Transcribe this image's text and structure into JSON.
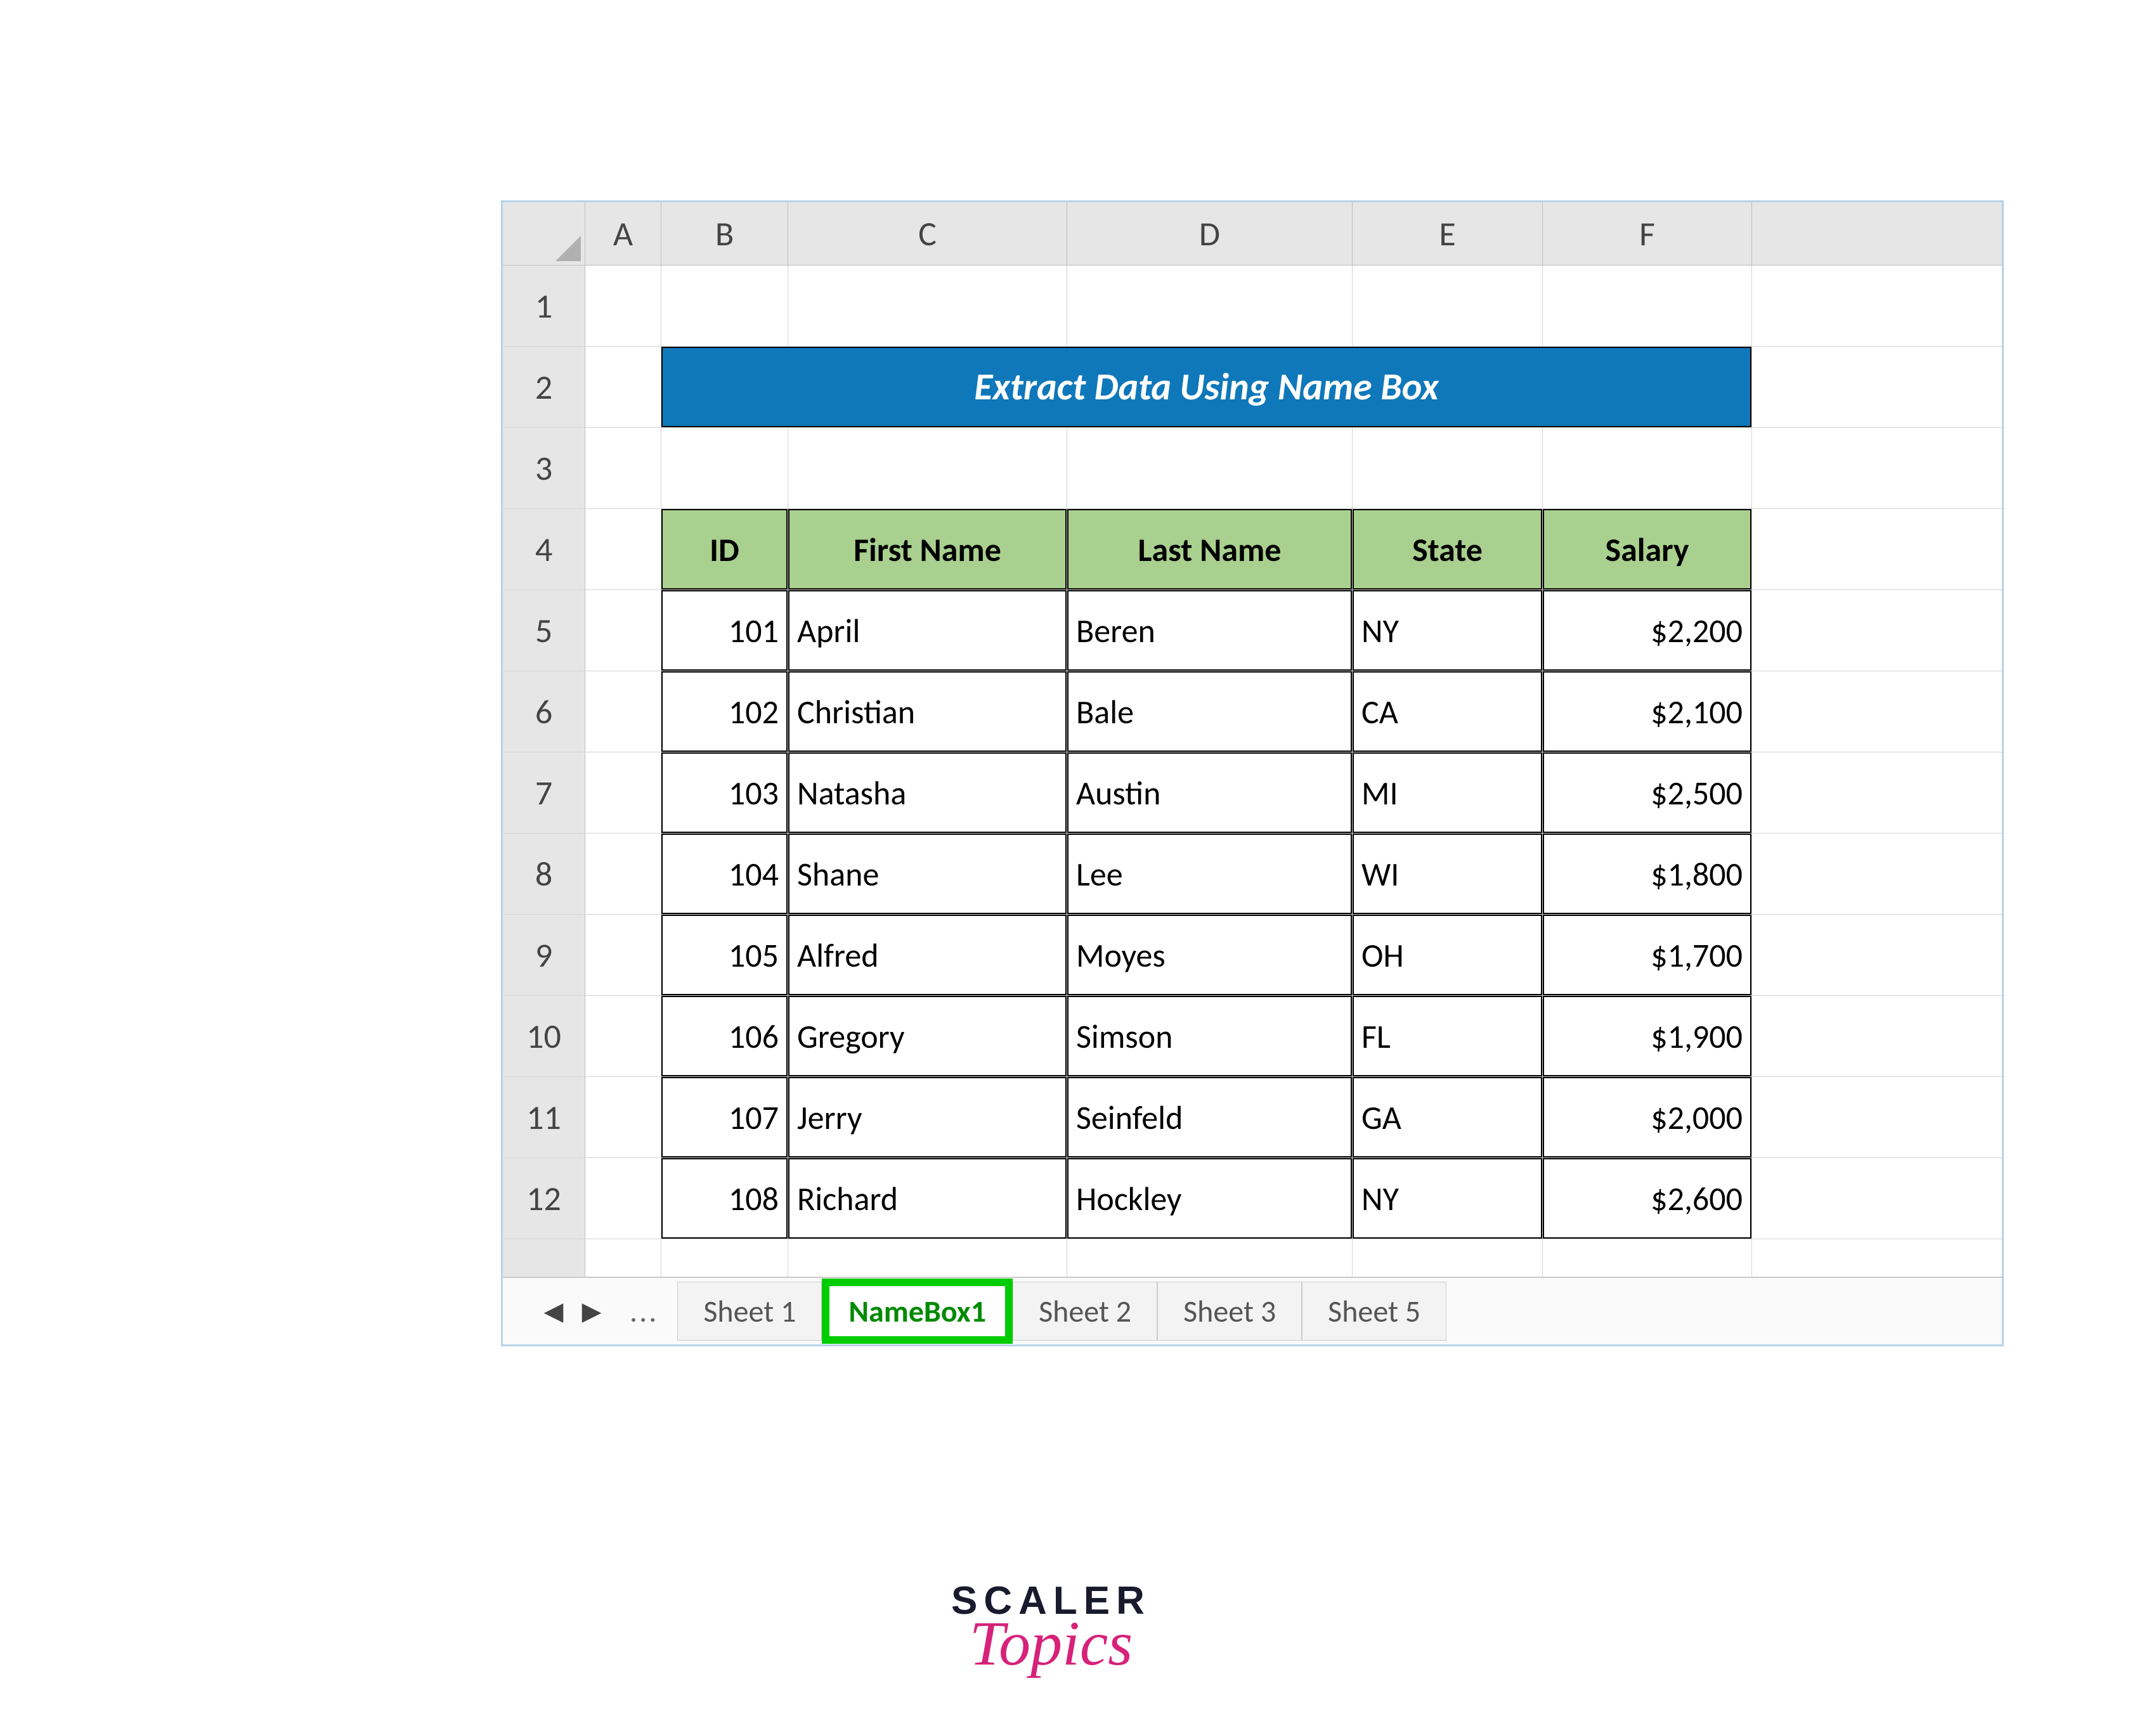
{
  "columns": [
    "A",
    "B",
    "C",
    "D",
    "E",
    "F"
  ],
  "row_numbers": [
    "1",
    "2",
    "3",
    "4",
    "5",
    "6",
    "7",
    "8",
    "9",
    "10",
    "11",
    "12"
  ],
  "banner_title": "Extract Data Using Name Box",
  "table": {
    "headers": [
      "ID",
      "First Name",
      "Last Name",
      "State",
      "Salary"
    ],
    "rows": [
      {
        "id": "101",
        "first": "April",
        "last": "Beren",
        "state": "NY",
        "salary": "$2,200"
      },
      {
        "id": "102",
        "first": "Christian",
        "last": "Bale",
        "state": "CA",
        "salary": "$2,100"
      },
      {
        "id": "103",
        "first": "Natasha",
        "last": "Austin",
        "state": "MI",
        "salary": "$2,500"
      },
      {
        "id": "104",
        "first": "Shane",
        "last": "Lee",
        "state": "WI",
        "salary": "$1,800"
      },
      {
        "id": "105",
        "first": "Alfred",
        "last": "Moyes",
        "state": "OH",
        "salary": "$1,700"
      },
      {
        "id": "106",
        "first": "Gregory",
        "last": "Simson",
        "state": "FL",
        "salary": "$1,900"
      },
      {
        "id": "107",
        "first": "Jerry",
        "last": "Seinfeld",
        "state": "GA",
        "salary": "$2,000"
      },
      {
        "id": "108",
        "first": "Richard",
        "last": "Hockley",
        "state": "NY",
        "salary": "$2,600"
      }
    ]
  },
  "tabs": {
    "ellipsis": "...",
    "items": [
      "Sheet 1",
      "NameBox1",
      "Sheet 2",
      "Sheet 3",
      "Sheet 5"
    ],
    "active": "NameBox1"
  },
  "logo": {
    "line1": "SCALER",
    "line2": "Topics"
  }
}
